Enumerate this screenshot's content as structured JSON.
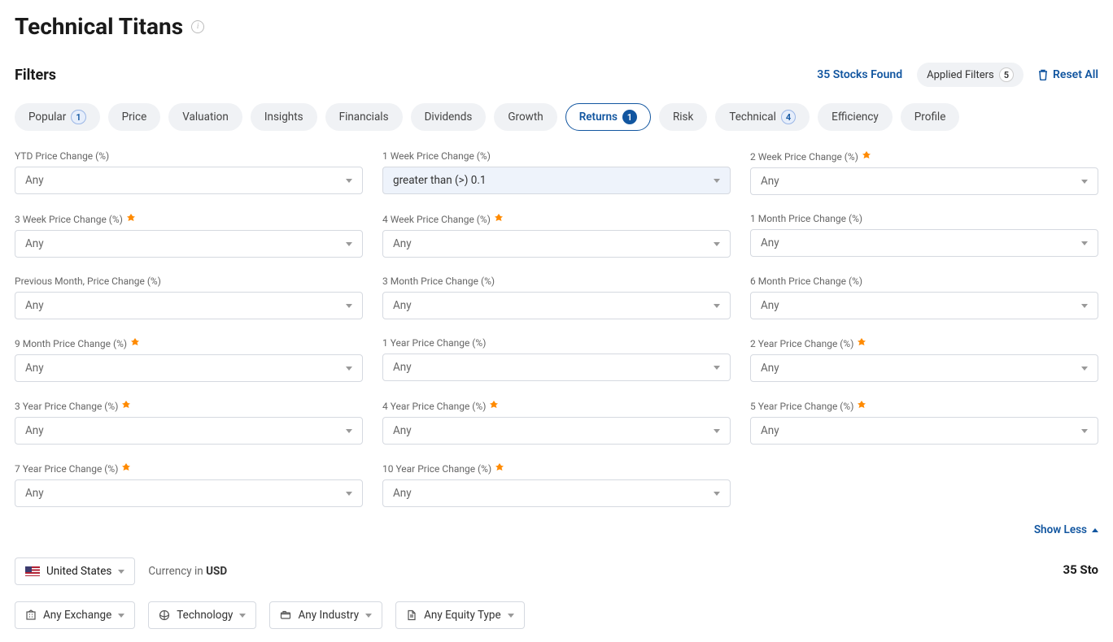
{
  "page": {
    "title": "Technical Titans"
  },
  "filters_header": {
    "title": "Filters",
    "stocks_found": "35 Stocks Found",
    "applied_filters_label": "Applied Filters",
    "applied_filters_count": "5",
    "reset_all": "Reset All"
  },
  "pills": [
    {
      "label": "Popular",
      "count": "1",
      "active": false,
      "count_style": "blue-outline"
    },
    {
      "label": "Price",
      "count": null,
      "active": false
    },
    {
      "label": "Valuation",
      "count": null,
      "active": false
    },
    {
      "label": "Insights",
      "count": null,
      "active": false
    },
    {
      "label": "Financials",
      "count": null,
      "active": false
    },
    {
      "label": "Dividends",
      "count": null,
      "active": false
    },
    {
      "label": "Growth",
      "count": null,
      "active": false
    },
    {
      "label": "Returns",
      "count": "1",
      "active": true,
      "count_style": "blue-solid"
    },
    {
      "label": "Risk",
      "count": null,
      "active": false
    },
    {
      "label": "Technical",
      "count": "4",
      "active": false,
      "count_style": "blue-outline"
    },
    {
      "label": "Efficiency",
      "count": null,
      "active": false
    },
    {
      "label": "Profile",
      "count": null,
      "active": false
    }
  ],
  "filter_items": [
    {
      "label": "YTD Price Change (%)",
      "value": "Any",
      "premium": false
    },
    {
      "label": "1 Week Price Change (%)",
      "value": "greater than (>) 0.1",
      "premium": false,
      "has_value": true
    },
    {
      "label": "2 Week Price Change (%)",
      "value": "Any",
      "premium": true
    },
    {
      "label": "3 Week Price Change (%)",
      "value": "Any",
      "premium": true
    },
    {
      "label": "4 Week Price Change (%)",
      "value": "Any",
      "premium": true
    },
    {
      "label": "1 Month Price Change (%)",
      "value": "Any",
      "premium": false
    },
    {
      "label": "Previous Month, Price Change (%)",
      "value": "Any",
      "premium": false
    },
    {
      "label": "3 Month Price Change (%)",
      "value": "Any",
      "premium": false
    },
    {
      "label": "6 Month Price Change (%)",
      "value": "Any",
      "premium": false
    },
    {
      "label": "9 Month Price Change (%)",
      "value": "Any",
      "premium": true
    },
    {
      "label": "1 Year Price Change (%)",
      "value": "Any",
      "premium": false
    },
    {
      "label": "2 Year Price Change (%)",
      "value": "Any",
      "premium": true
    },
    {
      "label": "3 Year Price Change (%)",
      "value": "Any",
      "premium": true
    },
    {
      "label": "4 Year Price Change (%)",
      "value": "Any",
      "premium": true
    },
    {
      "label": "5 Year Price Change (%)",
      "value": "Any",
      "premium": true
    },
    {
      "label": "7 Year Price Change (%)",
      "value": "Any",
      "premium": true
    },
    {
      "label": "10 Year Price Change (%)",
      "value": "Any",
      "premium": true
    }
  ],
  "show_less": "Show Less",
  "bottom": {
    "country": "United States",
    "currency_prefix": "Currency in ",
    "currency": "USD",
    "selects": [
      {
        "icon": "building",
        "label": "Any Exchange"
      },
      {
        "icon": "tech",
        "label": "Technology"
      },
      {
        "icon": "folder",
        "label": "Any Industry"
      },
      {
        "icon": "doc",
        "label": "Any Equity Type"
      }
    ],
    "count_suffix": "35 Sto"
  }
}
